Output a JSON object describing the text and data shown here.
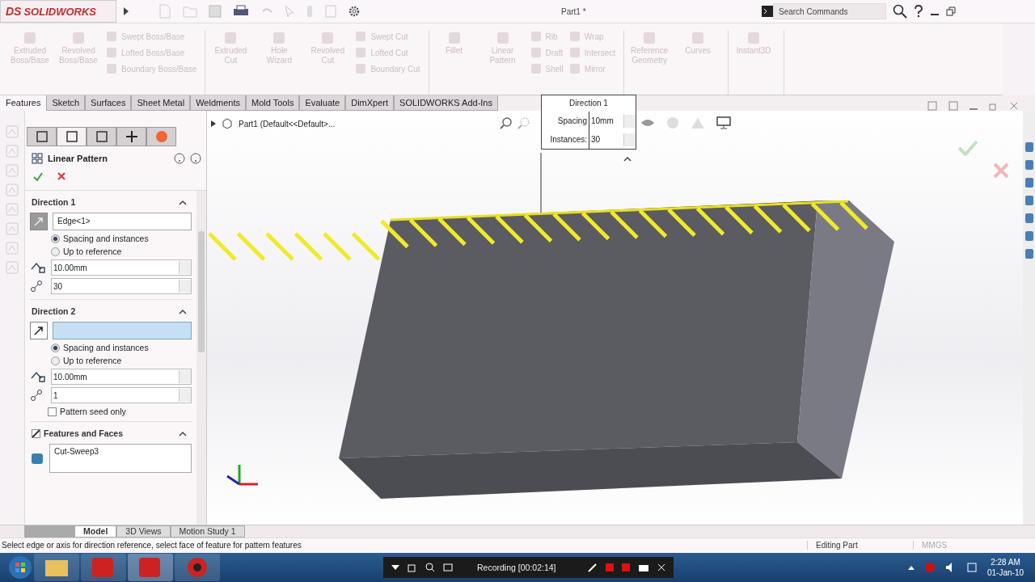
{
  "app": {
    "logo_mark": "DS",
    "logo": "SOLIDWORKS",
    "title": "Part1 *",
    "search": {
      "placeholder": "Search Commands"
    }
  },
  "ribbon": {
    "groups": [
      {
        "items": [
          {
            "kind": "large",
            "label": "Extruded Boss/Base",
            "disabled": true
          },
          {
            "kind": "large",
            "label": "Revolved Boss/Base",
            "disabled": true
          },
          {
            "kind": "stack",
            "items": [
              {
                "label": "Swept Boss/Base",
                "disabled": true
              },
              {
                "label": "Lofted Boss/Base",
                "disabled": true
              },
              {
                "label": "Boundary Boss/Base",
                "disabled": true
              }
            ]
          }
        ]
      },
      {
        "items": [
          {
            "kind": "large",
            "label": "Extruded Cut",
            "disabled": true
          },
          {
            "kind": "large",
            "label": "Hole Wizard",
            "disabled": true
          },
          {
            "kind": "large",
            "label": "Revolved Cut",
            "disabled": true
          },
          {
            "kind": "stack",
            "items": [
              {
                "label": "Swept Cut",
                "disabled": true
              },
              {
                "label": "Lofted Cut",
                "disabled": true
              },
              {
                "label": "Boundary Cut",
                "disabled": true
              }
            ]
          }
        ]
      },
      {
        "items": [
          {
            "kind": "large",
            "label": "Fillet",
            "disabled": true
          },
          {
            "kind": "large",
            "label": "Linear Pattern",
            "disabled": true
          },
          {
            "kind": "stack",
            "items": [
              {
                "label": "Rib",
                "disabled": true
              },
              {
                "label": "Draft",
                "disabled": true
              },
              {
                "label": "Shell",
                "disabled": true
              }
            ]
          },
          {
            "kind": "stack",
            "items": [
              {
                "label": "Wrap",
                "disabled": true
              },
              {
                "label": "Intersect",
                "disabled": true
              },
              {
                "label": "Mirror",
                "disabled": true
              }
            ]
          }
        ]
      },
      {
        "items": [
          {
            "kind": "large",
            "label": "Reference Geometry",
            "disabled": true
          },
          {
            "kind": "large",
            "label": "Curves",
            "disabled": true
          }
        ]
      },
      {
        "items": [
          {
            "kind": "large",
            "label": "Instant3D",
            "disabled": true
          }
        ]
      }
    ]
  },
  "tabs": [
    {
      "label": "Features",
      "selected": true
    },
    {
      "label": "Sketch",
      "selected": false
    },
    {
      "label": "Surfaces",
      "selected": false
    },
    {
      "label": "Sheet Metal",
      "selected": false
    },
    {
      "label": "Weldments",
      "selected": false
    },
    {
      "label": "Mold Tools",
      "selected": false
    },
    {
      "label": "Evaluate",
      "selected": false
    },
    {
      "label": "DimXpert",
      "selected": false
    },
    {
      "label": "SOLIDWORKS Add-Ins",
      "selected": false
    }
  ],
  "property_manager": {
    "tabs": [
      {
        "selected": false
      },
      {
        "selected": true
      },
      {
        "selected": false
      },
      {
        "selected": false
      },
      {
        "selected": false
      }
    ],
    "title": "Linear Pattern",
    "direction_1": {
      "title": "Direction 1",
      "reference": {
        "value": "Edge<1>",
        "active": false
      },
      "options": [
        {
          "label": "Spacing and instances",
          "selected": true
        },
        {
          "label": "Up to reference",
          "selected": false
        }
      ],
      "spacing": "10.00mm",
      "instances": "30"
    },
    "direction_2": {
      "title": "Direction 2",
      "reference": {
        "active": true
      },
      "options": [
        {
          "label": "Spacing and instances",
          "selected": true
        },
        {
          "label": "Up to reference",
          "selected": false
        }
      ],
      "spacing": "10.00mm",
      "instances": "1",
      "seed_only": {
        "label": "Pattern seed only",
        "checked": false
      }
    },
    "features_and_faces": {
      "title": "Features and Faces",
      "checked": true,
      "items": [
        "Cut-Sweep3"
      ]
    }
  },
  "viewport": {
    "breadcrumb": "Part1  (Default<<Default>...",
    "callout": {
      "title": "Direction 1",
      "spacing_label": "Spacing",
      "spacing": "10mm",
      "instances_label": "Instances:",
      "instances": "30"
    }
  },
  "bottom_tabs": [
    {
      "label": "Model",
      "selected": true
    },
    {
      "label": "3D Views",
      "selected": false
    },
    {
      "label": "Motion Study 1",
      "selected": false
    }
  ],
  "status_bar": {
    "message": "Select edge or axis for direction reference, select face of feature for pattern features",
    "mode": "Editing Part",
    "units": "MMGS"
  },
  "taskbar": {
    "recording": "Recording [00:02:14]",
    "time": "2:28 AM",
    "date": "01-Jan-10"
  }
}
